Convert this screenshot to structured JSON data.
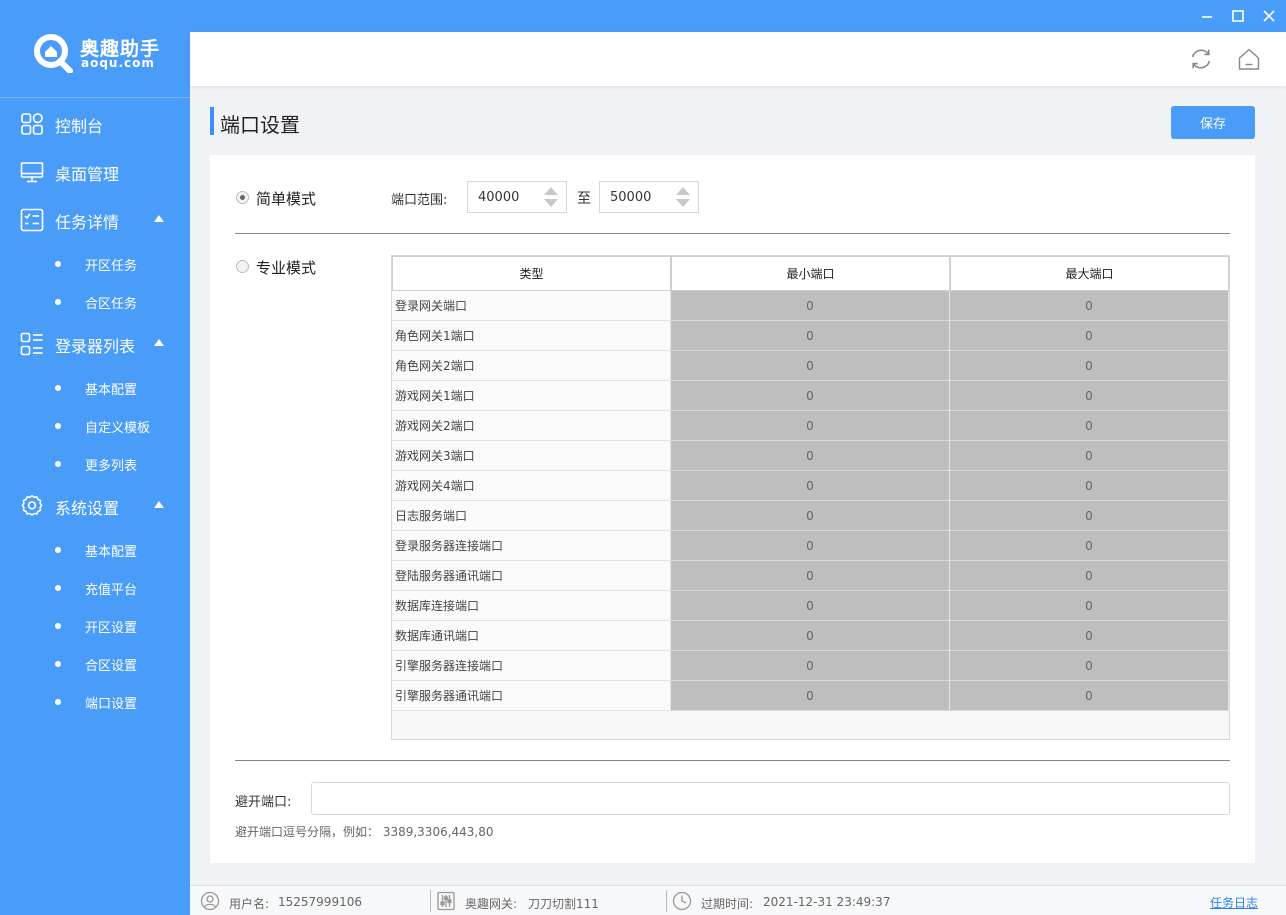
{
  "app": {
    "brand": "奥趣助手",
    "domain": "aoqu.com"
  },
  "window_controls": {
    "minimize": "–",
    "maximize": "☐",
    "close": "✕"
  },
  "sidebar": {
    "items": [
      {
        "label": "控制台",
        "icon": "dashboard-icon"
      },
      {
        "label": "桌面管理",
        "icon": "monitor-icon"
      },
      {
        "label": "任务详情",
        "icon": "task-list-icon",
        "expanded": true,
        "children": [
          "开区任务",
          "合区任务"
        ]
      },
      {
        "label": "登录器列表",
        "icon": "list-icon",
        "expanded": true,
        "children": [
          "基本配置",
          "自定义模板",
          "更多列表"
        ]
      },
      {
        "label": "系统设置",
        "icon": "gear-icon",
        "expanded": true,
        "children": [
          "基本配置",
          "充值平台",
          "开区设置",
          "合区设置",
          "端口设置"
        ]
      }
    ]
  },
  "header": {
    "refresh_icon": "refresh-icon",
    "home_icon": "home-icon"
  },
  "page": {
    "title": "端口设置",
    "save_label": "保存"
  },
  "simple_mode": {
    "label": "简单模式",
    "checked": true,
    "range_label": "端口范围:",
    "from_value": "40000",
    "to_label": "至",
    "to_value": "50000"
  },
  "pro_mode": {
    "label": "专业模式",
    "checked": false
  },
  "port_table": {
    "headers": [
      "类型",
      "最小端口",
      "最大端口"
    ],
    "rows": [
      {
        "type": "登录网关端口",
        "min": "0",
        "max": "0"
      },
      {
        "type": "角色网关1端口",
        "min": "0",
        "max": "0"
      },
      {
        "type": "角色网关2端口",
        "min": "0",
        "max": "0"
      },
      {
        "type": "游戏网关1端口",
        "min": "0",
        "max": "0"
      },
      {
        "type": "游戏网关2端口",
        "min": "0",
        "max": "0"
      },
      {
        "type": "游戏网关3端口",
        "min": "0",
        "max": "0"
      },
      {
        "type": "游戏网关4端口",
        "min": "0",
        "max": "0"
      },
      {
        "type": "日志服务端口",
        "min": "0",
        "max": "0"
      },
      {
        "type": "登录服务器连接端口",
        "min": "0",
        "max": "0"
      },
      {
        "type": "登陆服务器通讯端口",
        "min": "0",
        "max": "0"
      },
      {
        "type": "数据库连接端口",
        "min": "0",
        "max": "0"
      },
      {
        "type": "数据库通讯端口",
        "min": "0",
        "max": "0"
      },
      {
        "type": "引擎服务器连接端口",
        "min": "0",
        "max": "0"
      },
      {
        "type": "引擎服务器通讯端口",
        "min": "0",
        "max": "0"
      }
    ]
  },
  "avoid_ports": {
    "label": "避开端口:",
    "value": "",
    "hint": "避开端口逗号分隔，例如： 3389,3306,443,80"
  },
  "status_bar": {
    "user_label": "用户名:",
    "user_value": "15257999106",
    "gateway_label": "奥趣网关:",
    "gateway_value": "刀刀切割111",
    "expire_label": "过期时间:",
    "expire_value": "2021-12-31 23:49:37",
    "log_link": "任务日志"
  },
  "colors": {
    "accent": "#4a9cf9",
    "title_bar_accent": "#3d8ef5",
    "disabled_cell": "#bebebe",
    "link": "#2f80ed"
  }
}
